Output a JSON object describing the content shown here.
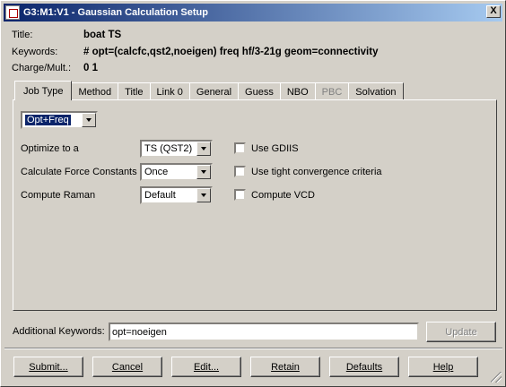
{
  "window": {
    "title": "G3:M1:V1 - Gaussian Calculation Setup",
    "close_label": "X"
  },
  "header": {
    "title_label": "Title:",
    "title_value": "boat TS",
    "keywords_label": "Keywords:",
    "keywords_value": "# opt=(calcfc,qst2,noeigen) freq hf/3-21g geom=connectivity",
    "charge_label": "Charge/Mult.:",
    "charge_value": "0 1"
  },
  "tabs": [
    {
      "label": "Job Type",
      "active": true,
      "disabled": false
    },
    {
      "label": "Method",
      "active": false,
      "disabled": false
    },
    {
      "label": "Title",
      "active": false,
      "disabled": false
    },
    {
      "label": "Link 0",
      "active": false,
      "disabled": false
    },
    {
      "label": "General",
      "active": false,
      "disabled": false
    },
    {
      "label": "Guess",
      "active": false,
      "disabled": false
    },
    {
      "label": "NBO",
      "active": false,
      "disabled": false
    },
    {
      "label": "PBC",
      "active": false,
      "disabled": true
    },
    {
      "label": "Solvation",
      "active": false,
      "disabled": false
    }
  ],
  "job_type": {
    "selected": "Opt+Freq",
    "optimize_label": "Optimize to a",
    "optimize_value": "TS (QST2)",
    "force_label": "Calculate Force Constants",
    "force_value": "Once",
    "raman_label": "Compute Raman",
    "raman_value": "Default",
    "gdiis_label": "Use GDIIS",
    "tight_label": "Use tight convergence criteria",
    "vcd_label": "Compute VCD"
  },
  "additional": {
    "label": "Additional Keywords:",
    "value": "opt=noeigen",
    "update_label": "Update"
  },
  "buttons": {
    "submit": "Submit...",
    "cancel": "Cancel",
    "edit": "Edit...",
    "retain": "Retain",
    "defaults": "Defaults",
    "help": "Help"
  }
}
